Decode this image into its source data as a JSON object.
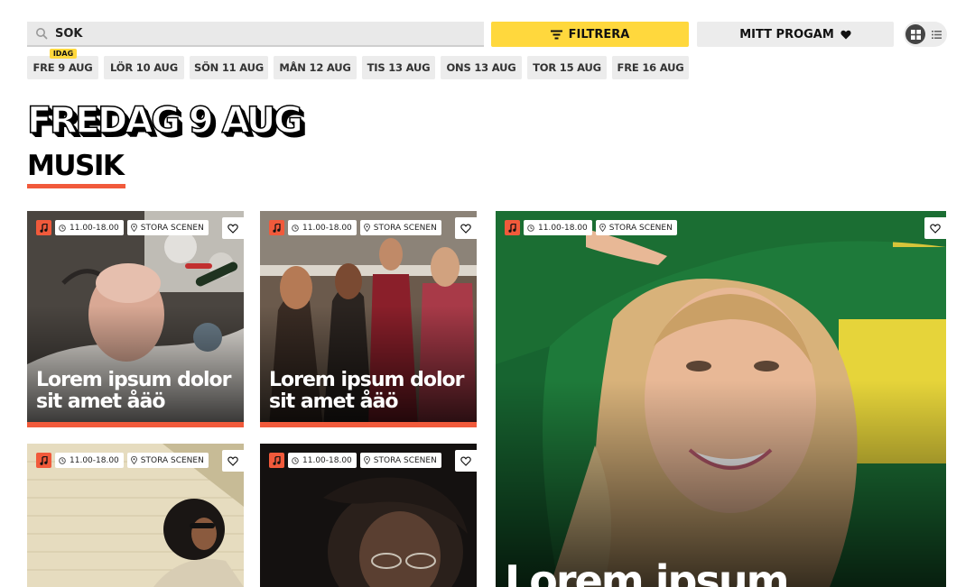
{
  "search": {
    "placeholder": "SÖK"
  },
  "toolbar": {
    "filter_label": "FILTRERA",
    "program_label": "MITT PROGAM"
  },
  "dates": {
    "today_badge": "IDAG",
    "items": [
      {
        "label": "FRE 9 AUG"
      },
      {
        "label": "LÖR 10 AUG"
      },
      {
        "label": "SÖN 11 AUG"
      },
      {
        "label": "MÅN 12 AUG"
      },
      {
        "label": "TIS 13 AUG"
      },
      {
        "label": "ONS 13 AUG"
      },
      {
        "label": "TOR 15 AUG"
      },
      {
        "label": "FRE 16 AUG"
      }
    ]
  },
  "heading": {
    "day": "FREDAG 9 AUG",
    "category": "MUSIK"
  },
  "colors": {
    "accent_yellow": "#ffd83d",
    "accent_red": "#f15a3b",
    "chip_grey": "#ececec"
  },
  "cards": [
    {
      "time": "11.00-18.00",
      "stage": "STORA SCENEN",
      "title": "Lorem ipsum dolor sit amet åäö"
    },
    {
      "time": "11.00-18.00",
      "stage": "STORA SCENEN",
      "title": "Lorem ipsum dolor sit amet åäö"
    },
    {
      "time": "11.00-18.00",
      "stage": "STORA SCENEN",
      "title": "Lorem ipsum"
    },
    {
      "time": "11.00-18.00",
      "stage": "STORA SCENEN",
      "title": ""
    },
    {
      "time": "11.00-18.00",
      "stage": "STORA SCENEN",
      "title": ""
    }
  ],
  "icons": {
    "search": "search-icon",
    "filter": "filter-icon",
    "heart": "heart-icon",
    "grid": "grid-view-icon",
    "list": "list-view-icon",
    "music": "music-note-icon",
    "clock": "clock-icon",
    "location": "location-pin-icon",
    "favorite": "heart-outline-icon"
  }
}
